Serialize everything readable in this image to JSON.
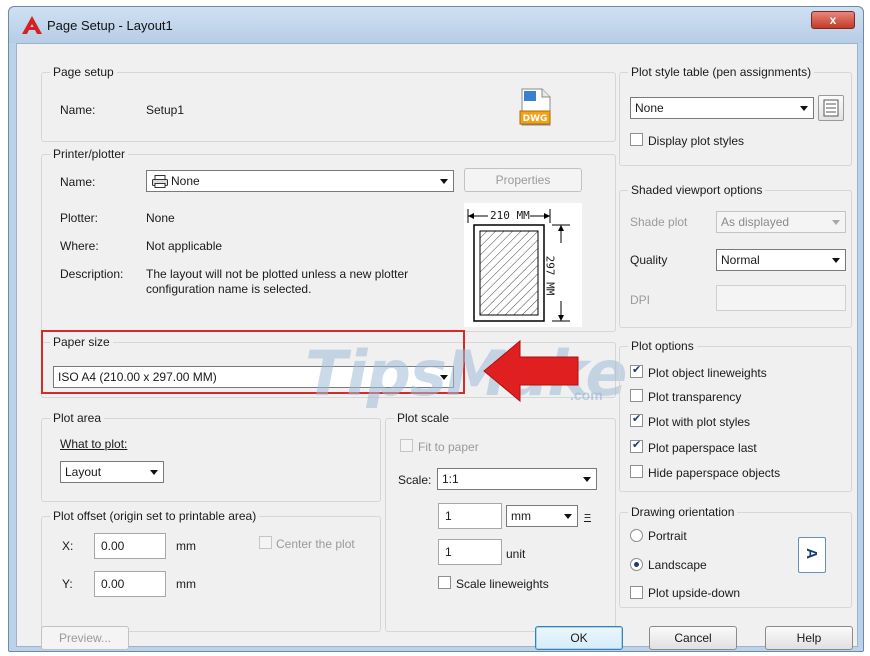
{
  "window": {
    "title": "Page Setup - Layout1",
    "close_label": "x"
  },
  "page_setup": {
    "group_title": "Page setup",
    "name_label": "Name:",
    "name_value": "Setup1",
    "file_icon_label": "DWG"
  },
  "printer": {
    "group_title": "Printer/plotter",
    "name_label": "Name:",
    "name_value": "None",
    "properties_label": "Properties",
    "plotter_label": "Plotter:",
    "plotter_value": "None",
    "where_label": "Where:",
    "where_value": "Not applicable",
    "description_label": "Description:",
    "description_line1": "The layout will not be plotted unless a new plotter",
    "description_line2": "configuration name is selected.",
    "preview_width": "210 MM",
    "preview_height": "297 MM"
  },
  "paper_size": {
    "group_title": "Paper size",
    "value": "ISO A4 (210.00 x 297.00 MM)"
  },
  "plot_area": {
    "group_title": "Plot area",
    "what_label": "What to plot:",
    "what_value": "Layout"
  },
  "plot_offset": {
    "group_title": "Plot offset (origin set to printable area)",
    "x_label": "X:",
    "x_value": "0.00",
    "x_unit": "mm",
    "y_label": "Y:",
    "y_value": "0.00",
    "y_unit": "mm",
    "center_label": "Center the plot"
  },
  "plot_scale": {
    "group_title": "Plot scale",
    "fit_label": "Fit to paper",
    "scale_label": "Scale:",
    "scale_value": "1:1",
    "num1": "1",
    "unit1": "mm",
    "equals": "=",
    "num2": "1",
    "unit2": "unit",
    "lineweights_label": "Scale lineweights"
  },
  "plot_style": {
    "group_title": "Plot style table (pen assignments)",
    "value": "None",
    "display_label": "Display plot styles"
  },
  "shaded": {
    "group_title": "Shaded viewport options",
    "shade_label": "Shade plot",
    "shade_value": "As displayed",
    "quality_label": "Quality",
    "quality_value": "Normal",
    "dpi_label": "DPI"
  },
  "plot_options": {
    "group_title": "Plot options",
    "items": [
      {
        "label": "Plot object lineweights",
        "checked": true
      },
      {
        "label": "Plot transparency",
        "checked": false
      },
      {
        "label": "Plot with plot styles",
        "checked": true
      },
      {
        "label": "Plot paperspace last",
        "checked": true
      },
      {
        "label": "Hide paperspace objects",
        "checked": false
      }
    ]
  },
  "orientation": {
    "group_title": "Drawing orientation",
    "portrait_label": "Portrait",
    "landscape_label": "Landscape",
    "upside_label": "Plot upside-down",
    "selected": "Landscape",
    "icon_glyph": "A"
  },
  "buttons": {
    "preview": "Preview...",
    "ok": "OK",
    "cancel": "Cancel",
    "help": "Help"
  },
  "watermark": {
    "text": "TipsMake",
    "suffix": ".com"
  },
  "colors": {
    "highlight": "#d62b2b",
    "arrow": "#e02020",
    "title_bg": "#bcd2ea"
  }
}
